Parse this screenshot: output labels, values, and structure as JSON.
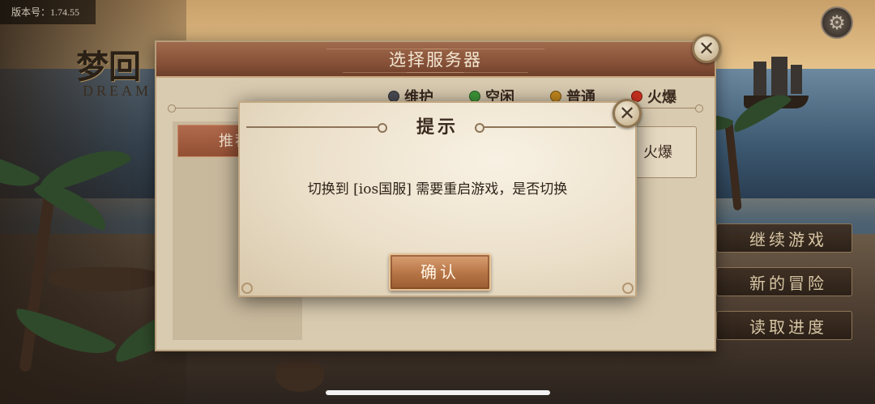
{
  "version": {
    "text": "版本号：1.74.55"
  },
  "logo": {
    "cn": "梦回",
    "en": "DREAM C"
  },
  "server_panel": {
    "title": "选择服务器",
    "legend": [
      {
        "label": "维护",
        "color": "#4b4e55"
      },
      {
        "label": "空闲",
        "color": "#3f9a3a"
      },
      {
        "label": "普通",
        "color": "#c58a1f"
      },
      {
        "label": "火爆",
        "color": "#c9301f"
      }
    ],
    "recommend_tab": "推荐",
    "server_entry_status": "火爆"
  },
  "hint_dialog": {
    "title": "提示",
    "message": "切换到 [ios国服] 需要重启游戏，是否切换",
    "confirm_label": "确认"
  },
  "side_menu": {
    "items": [
      {
        "label": "继续游戏"
      },
      {
        "label": "新的冒险"
      },
      {
        "label": "读取进度"
      }
    ]
  },
  "icons": {
    "close": "close-icon",
    "settings": "gear-icon"
  }
}
